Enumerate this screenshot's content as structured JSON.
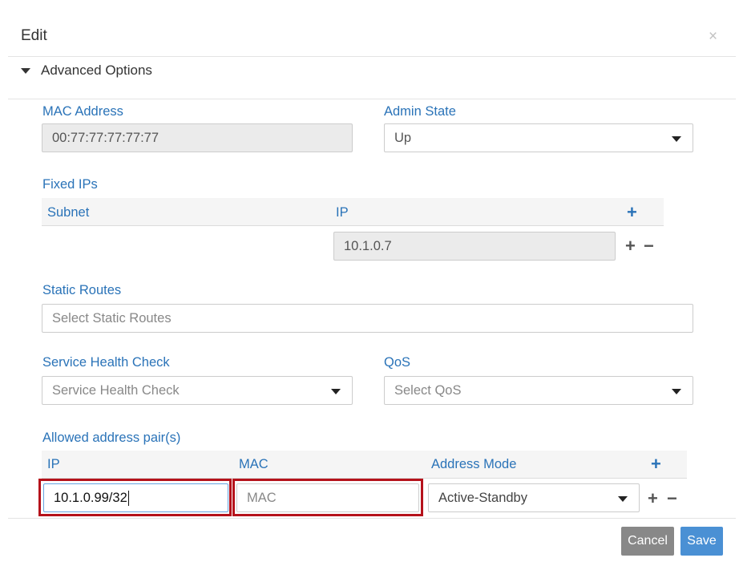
{
  "dialog": {
    "title": "Edit",
    "close_symbol": "×"
  },
  "advanced": {
    "label": "Advanced Options"
  },
  "mac_address": {
    "label": "MAC Address",
    "value": "00:77:77:77:77:77"
  },
  "admin_state": {
    "label": "Admin State",
    "value": "Up"
  },
  "fixed_ips": {
    "label": "Fixed IPs",
    "columns": [
      "Subnet",
      "IP"
    ],
    "rows": [
      {
        "subnet": "",
        "ip": "10.1.0.7"
      }
    ]
  },
  "static_routes": {
    "label": "Static Routes",
    "placeholder": "Select Static Routes"
  },
  "service_health_check": {
    "label": "Service Health Check",
    "placeholder": "Service Health Check"
  },
  "qos": {
    "label": "QoS",
    "placeholder": "Select QoS"
  },
  "allowed_pairs": {
    "label": "Allowed address pair(s)",
    "columns": [
      "IP",
      "MAC",
      "Address Mode"
    ],
    "row": {
      "ip": "10.1.0.99/32",
      "mac_placeholder": "MAC",
      "mode": "Active-Standby"
    }
  },
  "icons": {
    "plus": "+",
    "minus": "−"
  },
  "footer": {
    "cancel": "Cancel",
    "save": "Save"
  },
  "colors": {
    "accent": "#2a73b8",
    "highlight": "#b5121b",
    "save_bg": "#4a90d4",
    "cancel_bg": "#888888"
  }
}
